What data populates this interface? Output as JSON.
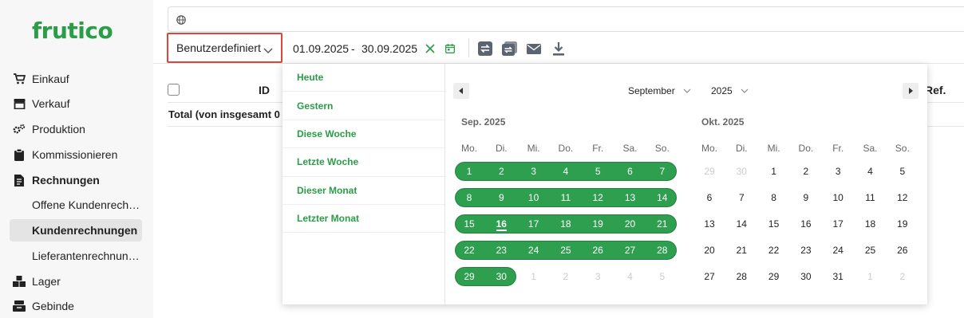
{
  "logo": "frutico",
  "sidebar": {
    "items": [
      {
        "label": "Einkauf",
        "icon": "cart-icon"
      },
      {
        "label": "Verkauf",
        "icon": "store-icon"
      },
      {
        "label": "Produktion",
        "icon": "gears-icon"
      },
      {
        "label": "Kommissionieren",
        "icon": "clipboard-icon"
      },
      {
        "label": "Rechnungen",
        "icon": "invoice-icon"
      },
      {
        "label": "Lager",
        "icon": "boxes-icon"
      },
      {
        "label": "Gebinde",
        "icon": "crate-icon"
      }
    ],
    "sub_items": [
      {
        "label": "Offene Kundenrech…",
        "active": false
      },
      {
        "label": "Kundenrechnungen",
        "active": true
      },
      {
        "label": "Lieferantenrechnun…",
        "active": false
      }
    ]
  },
  "toolbar": {
    "range_select": "Benutzerdefiniert",
    "date_from": "01.09.2025",
    "date_sep": "-",
    "date_to": "30.09.2025"
  },
  "table": {
    "col_id": "ID",
    "col_ref": "Ref.",
    "total": "Total (von insgesamt 0"
  },
  "picker": {
    "presets": [
      "Heute",
      "Gestern",
      "Diese Woche",
      "Letzte Woche",
      "Dieser Monat",
      "Letzter Monat"
    ],
    "month_select": "September",
    "year_select": "2025",
    "weekdays": [
      "Mo.",
      "Di.",
      "Mi.",
      "Do.",
      "Fr.",
      "Sa.",
      "So."
    ],
    "months": [
      {
        "title": "Sep. 2025",
        "weeks": [
          [
            "1",
            "2",
            "3",
            "4",
            "5",
            "6",
            "7"
          ],
          [
            "8",
            "9",
            "10",
            "11",
            "12",
            "13",
            "14"
          ],
          [
            "15",
            "16",
            "17",
            "18",
            "19",
            "20",
            "21"
          ],
          [
            "22",
            "23",
            "24",
            "25",
            "26",
            "27",
            "28"
          ],
          [
            "29",
            "30",
            "1",
            "2",
            "3",
            "4",
            "5"
          ]
        ],
        "muted_cells": [
          [
            4,
            2
          ],
          [
            4,
            3
          ],
          [
            4,
            4
          ],
          [
            4,
            5
          ],
          [
            4,
            6
          ]
        ],
        "selected_rows": [
          [
            0,
            6
          ],
          [
            0,
            6
          ],
          [
            0,
            6
          ],
          [
            0,
            6
          ],
          [
            0,
            1
          ]
        ],
        "today": [
          2,
          1
        ]
      },
      {
        "title": "Okt. 2025",
        "weeks": [
          [
            "29",
            "30",
            "1",
            "2",
            "3",
            "4",
            "5"
          ],
          [
            "6",
            "7",
            "8",
            "9",
            "10",
            "11",
            "12"
          ],
          [
            "13",
            "14",
            "15",
            "16",
            "17",
            "18",
            "19"
          ],
          [
            "20",
            "21",
            "22",
            "23",
            "24",
            "25",
            "26"
          ],
          [
            "27",
            "28",
            "29",
            "30",
            "31",
            "1",
            "2"
          ]
        ],
        "muted_cells": [
          [
            0,
            0
          ],
          [
            0,
            1
          ],
          [
            4,
            5
          ],
          [
            4,
            6
          ]
        ],
        "selected_rows": [],
        "today": null
      }
    ],
    "accent_color": "#2e9e4f"
  }
}
